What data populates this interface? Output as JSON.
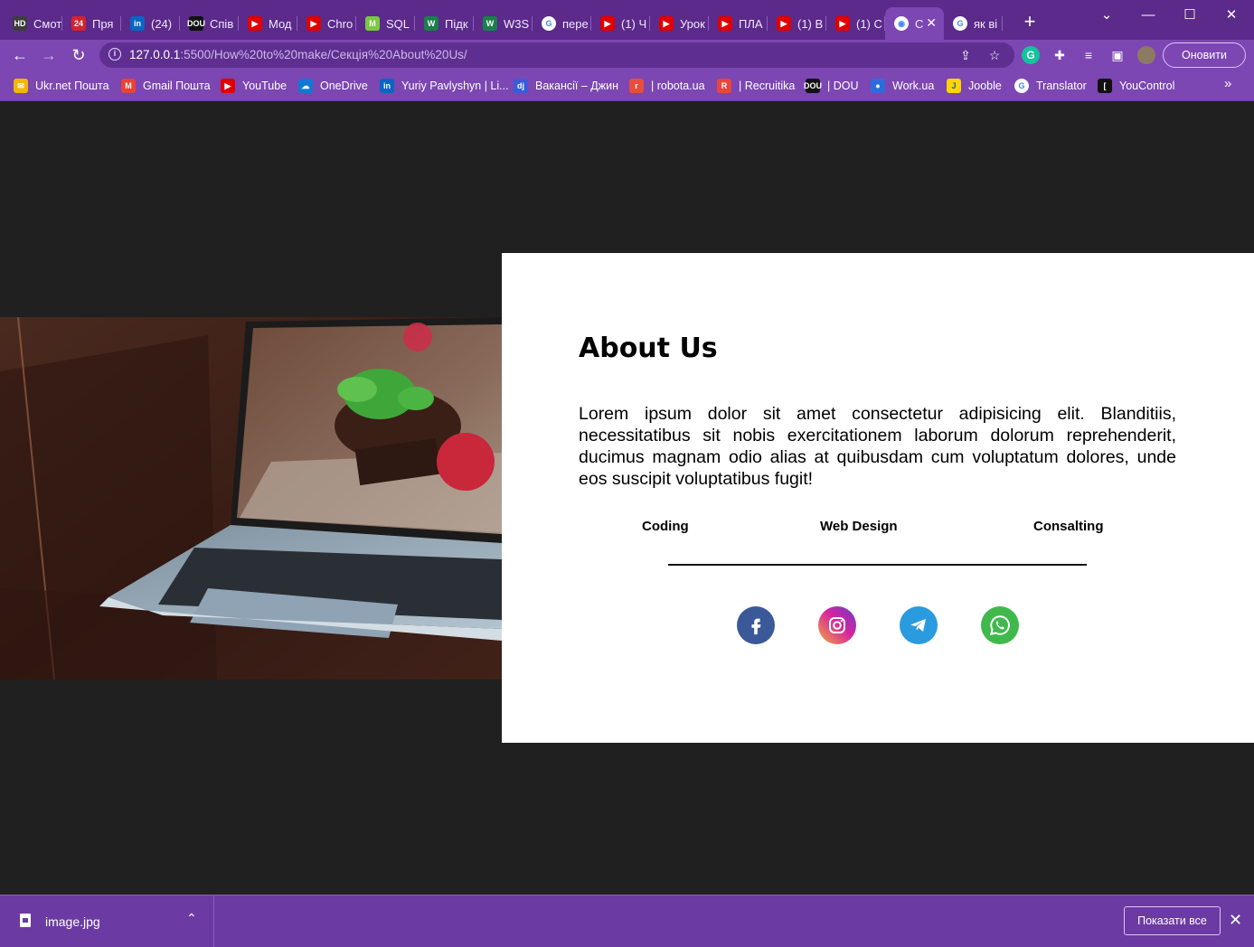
{
  "browser": {
    "tabs": [
      {
        "label": "Смот",
        "favicon": "hd-icon",
        "color": "#3d3d3d",
        "glyph": "HD"
      },
      {
        "label": "Пря",
        "favicon": "24-icon",
        "color": "#d3232f",
        "glyph": "24"
      },
      {
        "label": "(24)",
        "favicon": "linkedin-icon",
        "color": "#0a66c2",
        "glyph": "in"
      },
      {
        "label": "Спів",
        "favicon": "dou-icon",
        "color": "#111111",
        "glyph": "DOU"
      },
      {
        "label": "Мод",
        "favicon": "youtube-icon",
        "color": "#e00000",
        "glyph": "▶"
      },
      {
        "label": "Chro",
        "favicon": "youtube-icon",
        "color": "#e00000",
        "glyph": "▶"
      },
      {
        "label": "SQL",
        "favicon": "m-icon",
        "color": "#7ac943",
        "glyph": "M"
      },
      {
        "label": "Підк",
        "favicon": "w-icon",
        "color": "#1a7f4b",
        "glyph": "W"
      },
      {
        "label": "W3S",
        "favicon": "w-icon",
        "color": "#1a7f4b",
        "glyph": "W"
      },
      {
        "label": "пере",
        "favicon": "google-icon",
        "color": "#ffffff",
        "glyph": "G"
      },
      {
        "label": "(1) Ч",
        "favicon": "youtube-icon",
        "color": "#e00000",
        "glyph": "▶"
      },
      {
        "label": "Урок",
        "favicon": "youtube-icon",
        "color": "#e00000",
        "glyph": "▶"
      },
      {
        "label": "ПЛА",
        "favicon": "youtube-icon",
        "color": "#e00000",
        "glyph": "▶"
      },
      {
        "label": "(1) В",
        "favicon": "youtube-icon",
        "color": "#e00000",
        "glyph": "▶"
      },
      {
        "label": "(1) С",
        "favicon": "youtube-icon",
        "color": "#e00000",
        "glyph": "▶"
      },
      {
        "label": "С",
        "favicon": "globe-icon",
        "color": "#ffffff",
        "glyph": "◉",
        "active": true
      },
      {
        "label": "як ві",
        "favicon": "google-icon",
        "color": "#ffffff",
        "glyph": "G"
      }
    ],
    "url_host": "127.0.0.1",
    "url_rest": ":5500/How%20to%20make/Секція%20About%20Us/",
    "update_button": "Оновити",
    "bookmarks": [
      {
        "label": "Ukr.net Пошта",
        "icon": "ukrnet-icon",
        "color": "#f2b705",
        "glyph": "✉"
      },
      {
        "label": "Gmail Пошта",
        "icon": "gmail-icon",
        "color": "#ea4335",
        "glyph": "M"
      },
      {
        "label": "YouTube",
        "icon": "youtube-icon",
        "color": "#e00000",
        "glyph": "▶"
      },
      {
        "label": "OneDrive",
        "icon": "onedrive-icon",
        "color": "#0f78d4",
        "glyph": "☁"
      },
      {
        "label": "Yuriy Pavlyshyn | Li...",
        "icon": "linkedin-icon",
        "color": "#0a66c2",
        "glyph": "in"
      },
      {
        "label": "Вакансії – Джин",
        "icon": "djinni-icon",
        "color": "#3b5bdb",
        "glyph": "dj"
      },
      {
        "label": "| robota.ua",
        "icon": "robota-icon",
        "color": "#e94e3c",
        "glyph": "r"
      },
      {
        "label": "| Recruitika",
        "icon": "recruitika-icon",
        "color": "#e8453c",
        "glyph": "R"
      },
      {
        "label": "| DOU",
        "icon": "dou-icon",
        "color": "#111111",
        "glyph": "DOU"
      },
      {
        "label": "Work.ua",
        "icon": "workua-icon",
        "color": "#2d6cdf",
        "glyph": "●"
      },
      {
        "label": "Jooble",
        "icon": "jooble-icon",
        "color": "#ffd500",
        "glyph": "J"
      },
      {
        "label": "Translator",
        "icon": "google-icon",
        "color": "#ffffff",
        "glyph": "G"
      },
      {
        "label": "YouControl",
        "icon": "youcontrol-icon",
        "color": "#111111",
        "glyph": "["
      }
    ]
  },
  "about": {
    "title": "About Us",
    "text": "Lorem ipsum dolor sit amet consectetur adipisicing elit. Blanditiis, necessitatibus sit nobis exercitationem laborum dolorum reprehenderit, ducimus magnam odio alias at quibusdam cum voluptatum dolores, unde eos suscipit voluptatibus fugit!",
    "services": [
      "Coding",
      "Web Design",
      "Consalting"
    ],
    "social": [
      {
        "name": "facebook-icon",
        "color": "#3b5998"
      },
      {
        "name": "instagram-icon",
        "color": "#c13584"
      },
      {
        "name": "telegram-icon",
        "color": "#2a9bdf"
      },
      {
        "name": "whatsapp-icon",
        "color": "#40b94c"
      }
    ]
  },
  "downloads": {
    "file_name": "image.jpg",
    "show_all": "Показати все"
  }
}
